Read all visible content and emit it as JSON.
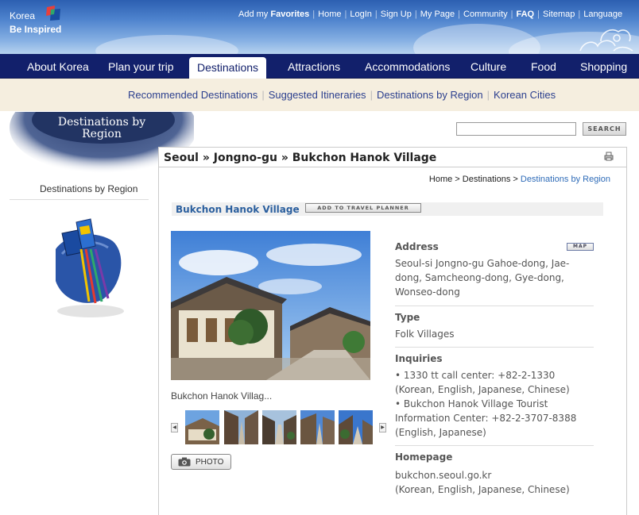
{
  "brand": {
    "line1": "Korea",
    "line2": "Be Inspired"
  },
  "topnav": {
    "favorites_prefix": "Add my",
    "favorites_bold": "Favorites",
    "home": "Home",
    "login": "LogIn",
    "signup": "Sign Up",
    "mypage": "My Page",
    "community": "Community",
    "faq": "FAQ",
    "sitemap": "Sitemap",
    "language": "Language"
  },
  "mainnav": {
    "tabs": [
      "About Korea",
      "Plan your trip",
      "Destinations",
      "Attractions",
      "Accommodations",
      "Culture",
      "Food",
      "Shopping"
    ],
    "active": "Destinations"
  },
  "subnav": [
    "Recommended Destinations",
    "Suggested Itineraries",
    "Destinations by Region",
    "Korean Cities"
  ],
  "sidebar": {
    "banner_title": "Destinations by Region",
    "label": "Destinations by Region"
  },
  "search": {
    "button": "SEARCH",
    "value": ""
  },
  "content": {
    "heading": "Seoul » Jongno-gu » Bukchon Hanok Village",
    "crumbs": {
      "home": "Home",
      "dest": "Destinations",
      "current": "Destinations by Region"
    },
    "place_name": "Bukchon Hanok Village",
    "planner_button": "ADD TO TRAVEL PLANNER",
    "caption": "Bukchon Hanok Villag...",
    "photo_button": "PHOTO",
    "info": {
      "address_label": "Address",
      "map_button": "MAP",
      "address": "Seoul-si Jongno-gu Gahoe-dong, Jae-dong, Samcheong-dong, Gye-dong, Wonseo-dong",
      "type_label": "Type",
      "type": "Folk Villages",
      "inquiries_label": "Inquiries",
      "inquiry1": "• 1330 tt call center: +82-2-1330 (Korean, English, Japanese, Chinese)",
      "inquiry2": "• Bukchon Hanok Village Tourist Information Center: +82-2-3707-8388 (English, Japanese)",
      "homepage_label": "Homepage",
      "homepage": "bukchon.seoul.go.kr",
      "homepage_langs": "(Korean, English, Japanese, Chinese)"
    }
  },
  "colors": {
    "nav": "#12206b",
    "subnav_bg": "#f5eedf",
    "link": "#2b3f8e"
  }
}
